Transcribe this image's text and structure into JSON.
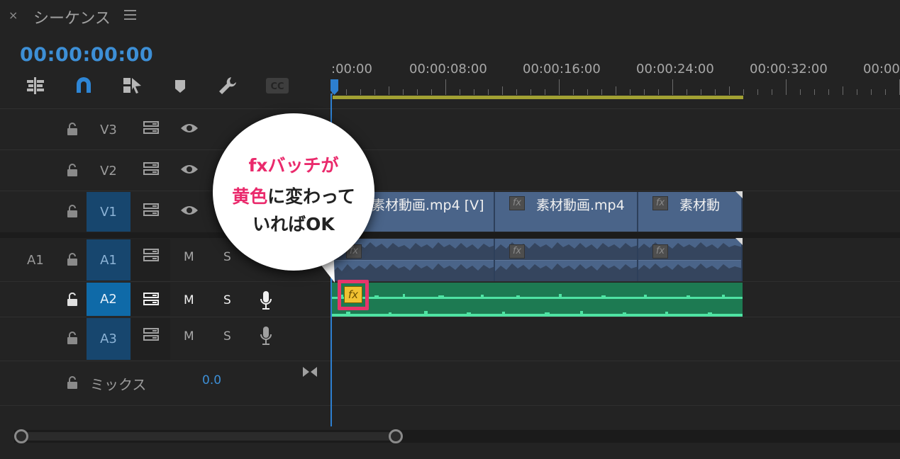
{
  "header": {
    "close_icon": "×",
    "title": "シーケンス",
    "menu_icon": "hamburger-icon"
  },
  "timecode": "00:00:00:00",
  "toolbar": {
    "icons": [
      "insert-overwrite-icon",
      "snap-magnet-icon",
      "linked-selection-icon",
      "marker-icon",
      "wrench-settings-icon",
      "captions-icon"
    ],
    "captions_label": "CC"
  },
  "ruler": {
    "labels": [
      ":00:00",
      "00:00:08:00",
      "00:00:16:00",
      "00:00:24:00",
      "00:00:32:00",
      "00:00"
    ]
  },
  "tracks": {
    "v3": {
      "label": "V3"
    },
    "v2": {
      "label": "V2"
    },
    "v1": {
      "label": "V1"
    },
    "a1": {
      "source": "A1",
      "label": "A1",
      "mute": "M",
      "solo": "S"
    },
    "a2": {
      "label": "A2",
      "mute": "M",
      "solo": "S"
    },
    "a3": {
      "label": "A3",
      "mute": "M",
      "solo": "S"
    }
  },
  "mix": {
    "label": "ミックス",
    "value": "0.0"
  },
  "clips": {
    "video": [
      {
        "name": "素材動画.mp4 [V]"
      },
      {
        "name": "素材動画.mp4"
      },
      {
        "name": "素材動"
      }
    ],
    "fx_label": "fx"
  },
  "callout": {
    "line1_highlight": "fxバッチが",
    "line2_highlight": "黄色",
    "line2_rest": "に変わって",
    "line3": "いればOK"
  },
  "colors": {
    "timecode": "#3d8fd6",
    "video_clip": "#4a6489",
    "audio_clip_active": "#1d7a52",
    "fx_badge_active": "#f1c232",
    "highlight": "#e7356c",
    "work_area": "#a2a133"
  }
}
